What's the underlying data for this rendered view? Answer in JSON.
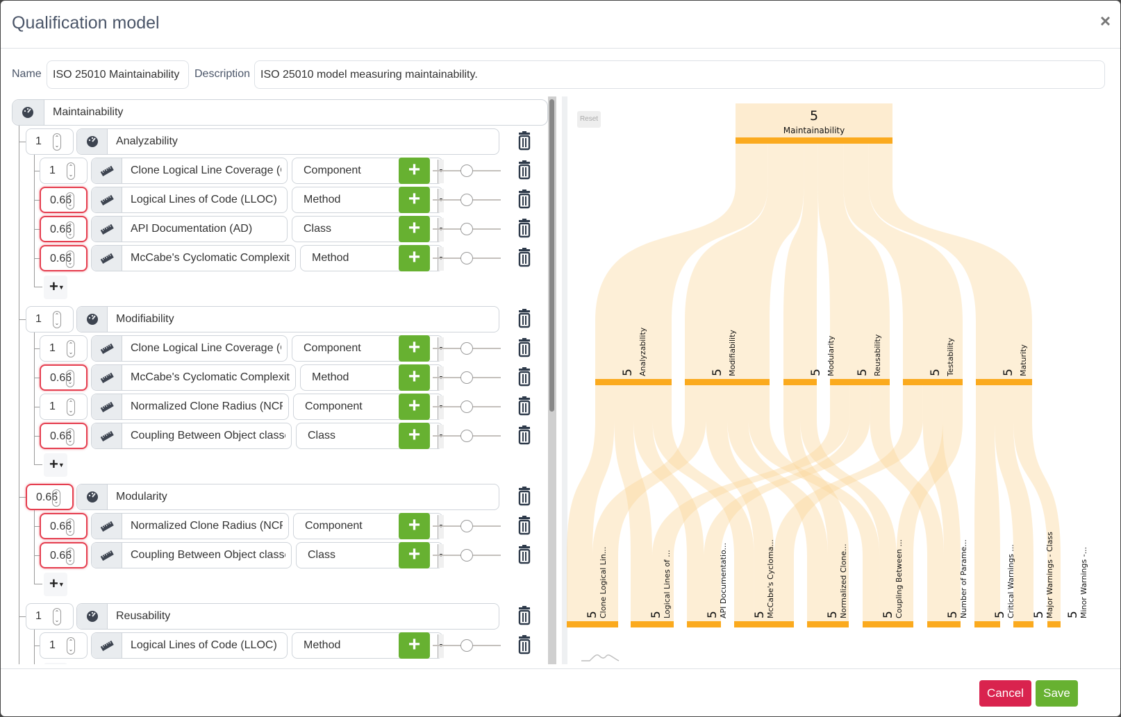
{
  "modal": {
    "title": "Qualification model",
    "close_label": "×"
  },
  "form": {
    "name_label": "Name",
    "name_value": "ISO 25010 Maintainability",
    "description_label": "Description",
    "description_value": "ISO 25010 model measuring maintainability."
  },
  "tree": {
    "root": "Maintainability",
    "groups": [
      {
        "weight": "1",
        "weight_invalid": false,
        "name": "Analyzability",
        "metrics": [
          {
            "weight": "1",
            "invalid": false,
            "name": "Clone Logical Line Coverage (CLLC)",
            "level": "Component"
          },
          {
            "weight": "0.66",
            "invalid": true,
            "name": "Logical Lines of Code (LLOC)",
            "level": "Method"
          },
          {
            "weight": "0.66",
            "invalid": true,
            "name": "API Documentation (AD)",
            "level": "Class"
          },
          {
            "weight": "0.66",
            "invalid": true,
            "name": "McCabe's Cyclomatic Complexity",
            "level": "Method"
          }
        ]
      },
      {
        "weight": "1",
        "weight_invalid": false,
        "name": "Modifiability",
        "metrics": [
          {
            "weight": "1",
            "invalid": false,
            "name": "Clone Logical Line Coverage (CLLC)",
            "level": "Component"
          },
          {
            "weight": "0.66",
            "invalid": true,
            "name": "McCabe's Cyclomatic Complexity",
            "level": "Method"
          },
          {
            "weight": "1",
            "invalid": false,
            "name": "Normalized Clone Radius (NCR)",
            "level": "Component"
          },
          {
            "weight": "0.66",
            "invalid": true,
            "name": "Coupling Between Object classes",
            "level": "Class"
          }
        ]
      },
      {
        "weight": "0.66",
        "weight_invalid": true,
        "name": "Modularity",
        "metrics": [
          {
            "weight": "0.66",
            "invalid": true,
            "name": "Normalized Clone Radius (NCR)",
            "level": "Component"
          },
          {
            "weight": "0.66",
            "invalid": true,
            "name": "Coupling Between Object classes",
            "level": "Class"
          }
        ]
      },
      {
        "weight": "1",
        "weight_invalid": false,
        "name": "Reusability",
        "metrics": [
          {
            "weight": "1",
            "invalid": false,
            "name": "Logical Lines of Code (LLOC)",
            "level": "Method"
          }
        ]
      }
    ],
    "add_label": "+",
    "slider_value": 0.5
  },
  "sankey": {
    "reset_label": "Reset",
    "root": {
      "value": "5",
      "label": "Maintainability"
    },
    "characteristics": [
      {
        "value": "5",
        "label": "Analyzability"
      },
      {
        "value": "5",
        "label": "Modifiability"
      },
      {
        "value": "5",
        "label": "Modularity"
      },
      {
        "value": "5",
        "label": "Reusability"
      },
      {
        "value": "5",
        "label": "Testability"
      },
      {
        "value": "5",
        "label": "Maturity"
      }
    ],
    "metrics": [
      {
        "value": "5",
        "label": "Clone Logical Lin..."
      },
      {
        "value": "5",
        "label": "Logical Lines of ..."
      },
      {
        "value": "5",
        "label": "API Documentatio..."
      },
      {
        "value": "5",
        "label": "McCabe's Cycloma..."
      },
      {
        "value": "5",
        "label": "Normalized Clone..."
      },
      {
        "value": "5",
        "label": "Coupling Between ..."
      },
      {
        "value": "5",
        "label": "Number of Parame..."
      },
      {
        "value": "5",
        "label": "Critical Warnings ..."
      },
      {
        "value": "5",
        "label": "Major Warnings - Class"
      },
      {
        "value": "5",
        "label": "Minor Warnings -..."
      }
    ],
    "colors": {
      "node": "#fbaa1e",
      "link": "#fdecd0"
    }
  },
  "footer": {
    "cancel_label": "Cancel",
    "save_label": "Save",
    "cancel_color": "#d9234e",
    "save_color": "#67b131"
  }
}
